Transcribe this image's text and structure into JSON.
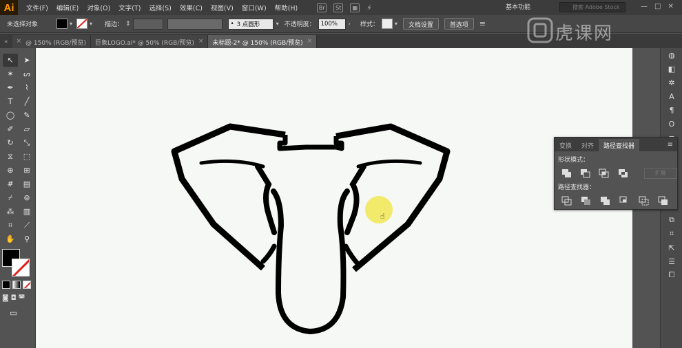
{
  "app": {
    "logo": "Ai",
    "accent": "#ff9a00"
  },
  "menu": [
    "文件(F)",
    "编辑(E)",
    "对象(O)",
    "文字(T)",
    "选择(S)",
    "效果(C)",
    "视图(V)",
    "窗口(W)",
    "帮助(H)"
  ],
  "menu_icons": {
    "bridge": "Br",
    "stock": "St"
  },
  "workspace": "基本功能",
  "stock_search_placeholder": "搜索 Adobe Stock",
  "control": {
    "selection_label": "未选择对象",
    "stroke_label": "描边：",
    "brush_value": "3 点圆形",
    "opacity_label": "不透明度：",
    "opacity_value": "100%",
    "style_label": "样式：",
    "doc_settings": "文档设置",
    "preferences": "首选项"
  },
  "tabs": [
    {
      "label": "@ 150% (RGB/预览)",
      "active": false
    },
    {
      "label": "巨象LOGO.ai* @ 50% (RGB/预览)",
      "active": false
    },
    {
      "label": "未标题-2* @ 150% (RGB/预览)",
      "active": true
    }
  ],
  "pathfinder": {
    "tabs": [
      "变换",
      "对齐",
      "路径查找器"
    ],
    "active_tab": 2,
    "shape_modes_label": "形状模式：",
    "pathfinders_label": "路径查找器：",
    "expand_label": "扩展"
  },
  "watermark": {
    "text": "虎课网"
  },
  "colors": {
    "fill": "#000000",
    "canvas_bg": "#f6f8f5",
    "highlight": "#f0e63c"
  }
}
